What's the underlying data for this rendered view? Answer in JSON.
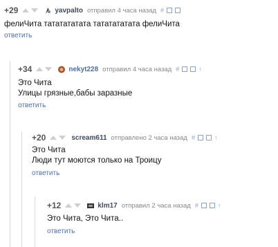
{
  "comments": [
    {
      "rating": "+29",
      "username": "yavpalto",
      "action": "отправил 4 часа назад",
      "lines": [
        "фелиЧита тататататата тататататата фелиЧита"
      ],
      "reply": "ответить",
      "icons": [
        "hash-icon",
        "minus-box-icon",
        "save-icon"
      ]
    },
    {
      "rating": "+34",
      "username": "nekyt228",
      "action": "отправил 4 часа назад",
      "lines": [
        "Это Чита",
        "Улицы грязные,бабы заразные"
      ],
      "reply": "ответить",
      "icons": [
        "hash-icon",
        "minus-box-icon",
        "save-icon",
        "arrow-up-icon"
      ]
    },
    {
      "rating": "+20",
      "username": "scream611",
      "action": "отправлено 2 часа назад",
      "lines": [
        "Это Чита",
        "Люди тут моются только на Троицу"
      ],
      "reply": "ответить",
      "icons": [
        "hash-icon",
        "minus-box-icon",
        "save-icon",
        "arrow-up-icon"
      ]
    },
    {
      "rating": "+12",
      "username": "klm17",
      "action": "отправил 2 часа назад",
      "lines": [
        "Это Чита, Это Чита.."
      ],
      "reply": "ответить",
      "icons": [
        "hash-icon",
        "minus-box-icon",
        "save-icon",
        "arrow-up-icon"
      ]
    }
  ],
  "glyphs": {
    "hash": "#",
    "up": "↑"
  }
}
